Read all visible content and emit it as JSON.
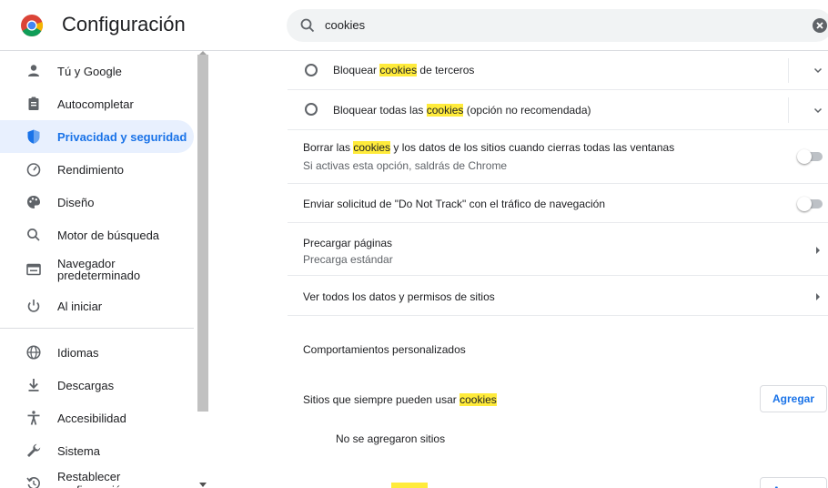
{
  "header": {
    "title": "Configuración",
    "search_value": "cookies",
    "logo_icon": "chrome-logo",
    "search_icon": "search-icon",
    "clear_icon": "clear-search-icon"
  },
  "sidebar": {
    "items": [
      {
        "label": "Tú y Google",
        "icon": "person-icon"
      },
      {
        "label": "Autocompletar",
        "icon": "clipboard-icon"
      },
      {
        "label": "Privacidad y seguridad",
        "icon": "shield-icon",
        "active": true
      },
      {
        "label": "Rendimiento",
        "icon": "speedometer-icon"
      },
      {
        "label": "Diseño",
        "icon": "palette-icon"
      },
      {
        "label": "Motor de búsqueda",
        "icon": "search-icon"
      },
      {
        "label_line1": "Navegador",
        "label_line2": "predeterminado",
        "icon": "browser-icon"
      },
      {
        "label": "Al iniciar",
        "icon": "power-icon"
      },
      {
        "label": "Idiomas",
        "icon": "globe-icon"
      },
      {
        "label": "Descargas",
        "icon": "download-icon"
      },
      {
        "label": "Accesibilidad",
        "icon": "accessibility-icon"
      },
      {
        "label": "Sistema",
        "icon": "wrench-icon"
      },
      {
        "label": "Restablecer configuración",
        "icon": "restore-icon"
      }
    ]
  },
  "main": {
    "block_third": {
      "pre": "Bloquear ",
      "hl": "cookies",
      "post": " de terceros"
    },
    "block_all": {
      "pre": "Bloquear todas las ",
      "hl": "cookies",
      "post": " (opción no recomendada)"
    },
    "clear_on_close": {
      "pre": "Borrar las ",
      "hl": "cookies",
      "post": " y los datos de los sitios cuando cierras todas las ventanas",
      "sub": "Si activas esta opción, saldrás de Chrome",
      "enabled": false
    },
    "do_not_track": {
      "label": "Enviar solicitud de \"Do Not Track\" con el tráfico de navegación",
      "enabled": false
    },
    "preload": {
      "label": "Precargar páginas",
      "sub": "Precarga estándar"
    },
    "all_site_data": {
      "label": "Ver todos los datos y permisos de sitios"
    },
    "custom_behaviors": {
      "title": "Comportamientos personalizados"
    },
    "always_allow": {
      "pre": "Sitios que siempre pueden usar ",
      "hl": "cookies",
      "add_label": "Agregar",
      "empty": "No se agregaron sitios"
    },
    "next_add_label": "Agregar"
  },
  "colors": {
    "accent": "#1a73e8",
    "active_bg": "#e8f0fe",
    "highlight": "#ffeb3b",
    "search_bg": "#f1f3f4"
  }
}
